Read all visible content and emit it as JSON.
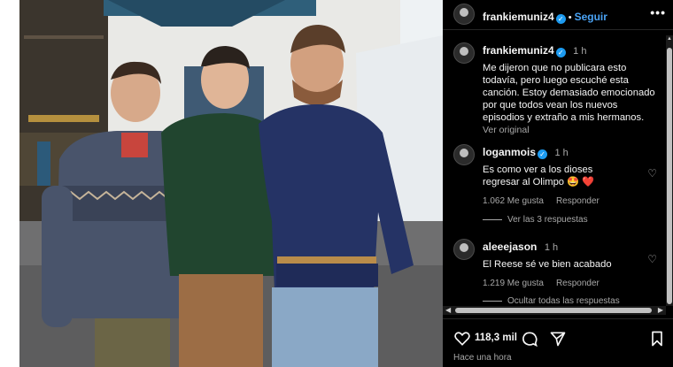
{
  "post": {
    "author": "frankiemuniz4",
    "follow_label": "Seguir",
    "more_label": "•••",
    "caption_time": "1 h",
    "caption": "Me dijeron que no publicara esto todavía, pero luego escuché esta canción. Estoy demasiado emocionado por que todos vean los nuevos episodios y extraño a mis hermanos.",
    "see_original": "Ver original",
    "likes": "118,3 mil",
    "posted_ago": "Hace una hora"
  },
  "comments": [
    {
      "user": "loganmois",
      "verified": true,
      "time": "1 h",
      "text": "Es como ver a los dioses regresar al Olimpo 🤩 ❤️",
      "likes": "1.062 Me gusta",
      "reply_label": "Responder",
      "replies_toggle": "Ver las 3 respuestas"
    },
    {
      "user": "aleeejason",
      "verified": false,
      "time": "1 h",
      "text": "El Reese sé ve bien acabado",
      "likes": "1.219 Me gusta",
      "reply_label": "Responder",
      "replies_toggle": "Ocultar todas las respuestas"
    }
  ],
  "icons": {
    "verified": "verified-badge-icon",
    "heart": "heart-icon",
    "comment": "comment-icon",
    "share": "share-icon",
    "save": "bookmark-icon",
    "more": "more-icon"
  },
  "colors": {
    "panel_bg": "#000000",
    "follow": "#4aa3f5",
    "verified": "#1d9bf0",
    "muted": "#a8a8a8"
  }
}
